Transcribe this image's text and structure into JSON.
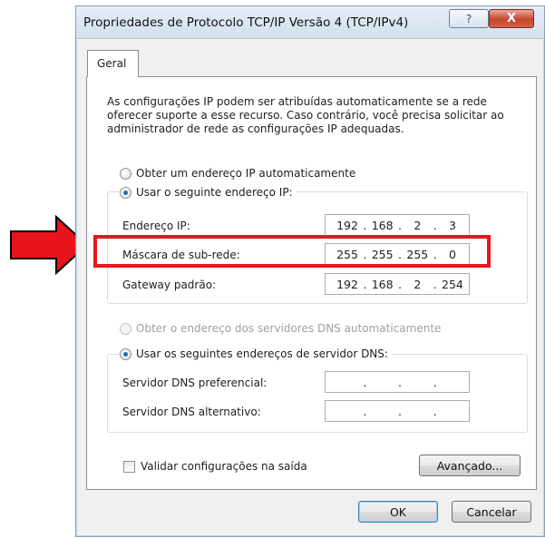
{
  "annotation": {
    "arrow_color": "#e8141c",
    "highlight_color": "#e8141c",
    "arrow_icon": "right-arrow-icon"
  },
  "window": {
    "title": "Propriedades de Protocolo TCP/IP Versão 4 (TCP/IPv4)",
    "help_label": "?",
    "close_label": "X"
  },
  "tabs": [
    {
      "label": "Geral",
      "selected": true
    }
  ],
  "general": {
    "description": "As configurações IP podem ser atribuídas automaticamente se a rede oferecer suporte a esse recurso. Caso contrário, você precisa solicitar ao administrador de rede as configurações IP adequadas.",
    "ip_auto_label": "Obter um endereço IP automaticamente",
    "ip_manual_label": "Usar o seguinte endereço IP:",
    "ip_mode": "manual",
    "ip_fields": [
      {
        "label": "Endereço IP:",
        "octets": [
          "192",
          "168",
          "2",
          "3"
        ]
      },
      {
        "label": "Máscara de sub-rede:",
        "octets": [
          "255",
          "255",
          "255",
          "0"
        ]
      },
      {
        "label": "Gateway padrão:",
        "octets": [
          "192",
          "168",
          "2",
          "254"
        ]
      }
    ],
    "dns_auto_label": "Obter o endereço dos servidores DNS automaticamente",
    "dns_manual_label": "Usar os seguintes endereços de servidor DNS:",
    "dns_mode": "manual",
    "dns_fields": [
      {
        "label": "Servidor DNS preferencial:",
        "octets": [
          "",
          "",
          "",
          ""
        ]
      },
      {
        "label": "Servidor DNS alternativo:",
        "octets": [
          "",
          "",
          "",
          ""
        ]
      }
    ],
    "validate_label": "Validar configurações na saída",
    "validate_checked": false,
    "advanced_label": "Avançado..."
  },
  "footer": {
    "ok_label": "OK",
    "cancel_label": "Cancelar"
  },
  "ip_separator": "."
}
